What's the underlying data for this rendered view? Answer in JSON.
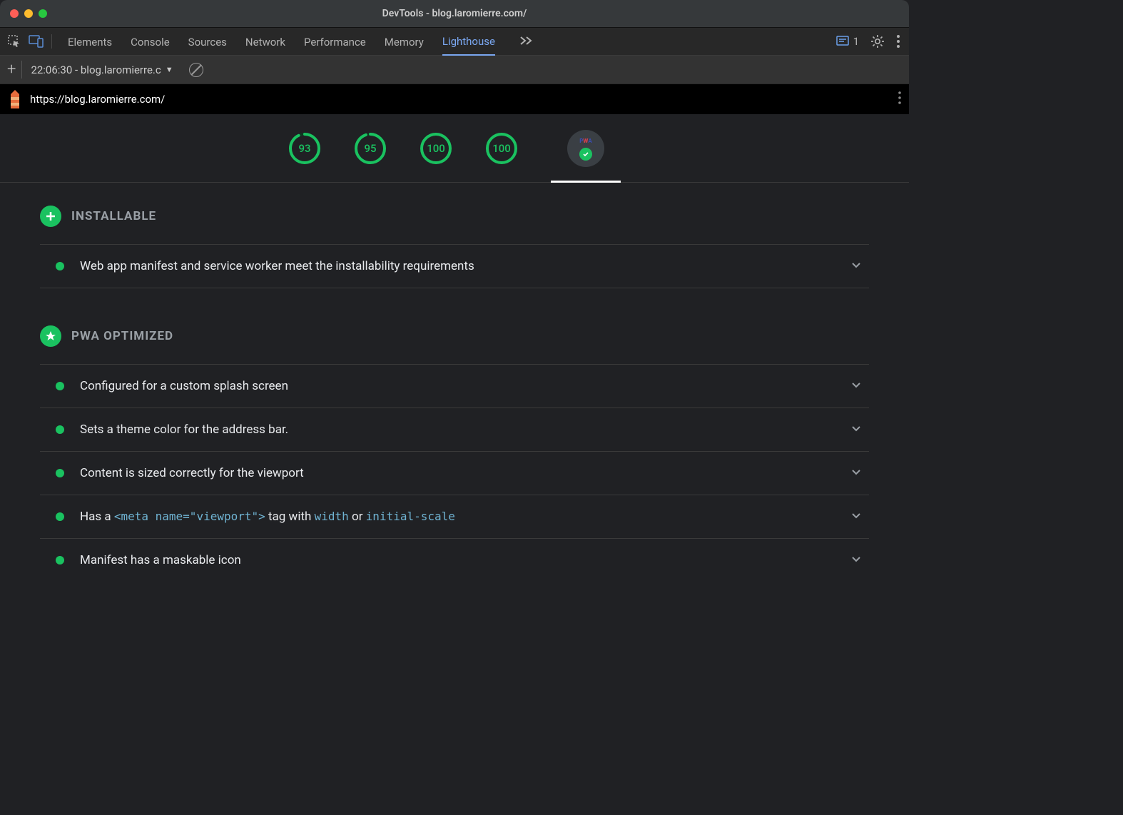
{
  "window": {
    "title": "DevTools - blog.laromierre.com/"
  },
  "tabs": {
    "items": [
      "Elements",
      "Console",
      "Sources",
      "Network",
      "Performance",
      "Memory",
      "Lighthouse"
    ],
    "active": "Lighthouse",
    "issues_count": "1"
  },
  "toolbar": {
    "report_label": "22:06:30 - blog.laromierre.c"
  },
  "url": "https://blog.laromierre.com/",
  "scores": [
    {
      "value": "93",
      "pct": 93
    },
    {
      "value": "95",
      "pct": 95
    },
    {
      "value": "100",
      "pct": 100
    },
    {
      "value": "100",
      "pct": 100
    }
  ],
  "pwa_badge_label": "PWA",
  "sections": [
    {
      "icon": "plus",
      "title": "INSTALLABLE",
      "audits": [
        {
          "text": "Web app manifest and service worker meet the installability requirements"
        }
      ]
    },
    {
      "icon": "star",
      "title": "PWA OPTIMIZED",
      "audits": [
        {
          "text": "Configured for a custom splash screen"
        },
        {
          "text": "Sets a theme color for the address bar."
        },
        {
          "text": "Content is sized correctly for the viewport"
        },
        {
          "html": "Has a <code>&lt;meta name=\"viewport\"&gt;</code> tag with <code>width</code> or <code>initial-scale</code>"
        },
        {
          "text": "Manifest has a maskable icon"
        }
      ]
    }
  ]
}
